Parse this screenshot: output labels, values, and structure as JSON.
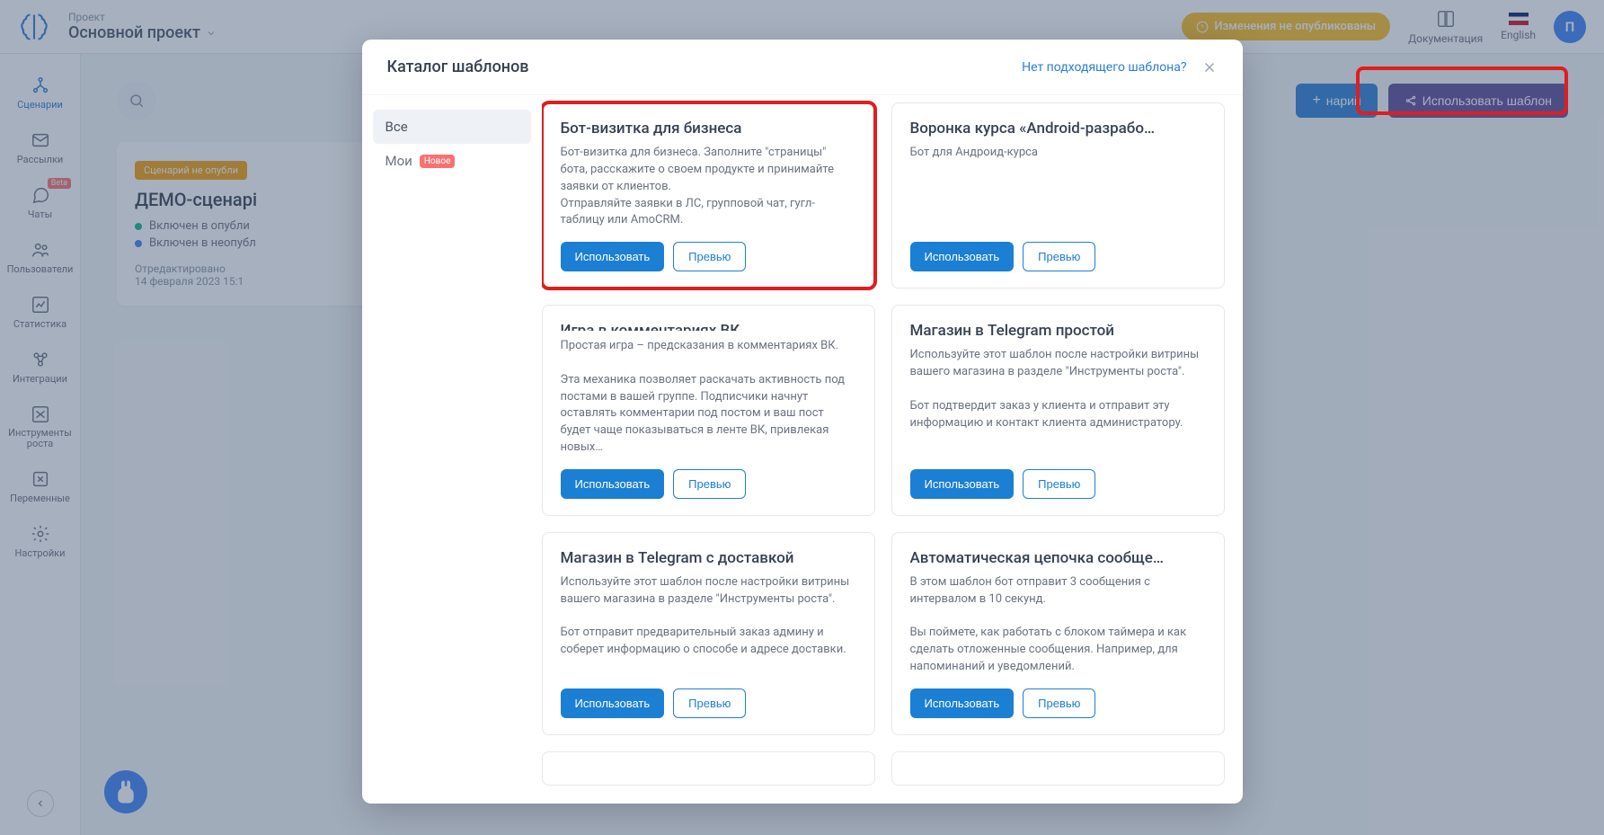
{
  "header": {
    "project_label": "Проект",
    "project_name": "Основной проект",
    "warning": "Изменения не опубликованы",
    "doc_label": "Документация",
    "lang_label": "English",
    "avatar_initial": "П"
  },
  "nav": {
    "items": [
      {
        "label": "Сценарии"
      },
      {
        "label": "Рассылки"
      },
      {
        "label": "Чаты",
        "badge": "Beta"
      },
      {
        "label": "Пользователи"
      },
      {
        "label": "Статистика"
      },
      {
        "label": "Интеграции"
      },
      {
        "label": "Инструменты роста"
      },
      {
        "label": "Переменные"
      },
      {
        "label": "Настройки"
      }
    ]
  },
  "main": {
    "scenario_tag": "Сценарий не опубли",
    "scenario_title": "ДЕМО-сценарі",
    "status_published": "Включен в опубли",
    "status_unpublished": "Включен в неопубл",
    "edited_label": "Отредактировано",
    "edited_value": "14 февраля 2023 15:1",
    "add_scenario_btn": "нарий",
    "use_template_btn": "Использовать шаблон"
  },
  "modal": {
    "title": "Каталог шаблонов",
    "no_suitable_link": "Нет подходящего шаблона?",
    "categories": {
      "all": "Все",
      "mine": "Мои",
      "mine_badge": "Новое"
    },
    "use_label": "Использовать",
    "preview_label": "Превью",
    "templates": [
      {
        "title": "Бот-визитка для бизнеса",
        "desc": "Бот-визитка для бизнеса. Заполните \"страницы\" бота, расскажите о своем продукте и принимайте заявки от клиентов.\nОтправляйте заявки в ЛС, групповой чат, гугл-таблицу или AmoCRM.",
        "highlighted": true
      },
      {
        "title": "Воронка курса «Android-разрабо…",
        "desc": "Бот для Андроид-курса"
      },
      {
        "title": "Игра в комментариях ВК",
        "desc": "Простая игра – предсказания в комментариях ВК.\n\nЭта механика позволяет раскачать активность под постами в вашей группе. Подписчики начнут оставлять комментарии под постом и ваш пост будет чаще показываться в ленте ВК, привлекая новых…"
      },
      {
        "title": "Магазин в Telegram простой",
        "desc": "Используйте этот шаблон после настройки витрины вашего магазина в разделе \"Инструменты роста\".\n\nБот подтвердит заказ у клиента и отправит эту информацию и контакт клиента администратору."
      },
      {
        "title": "Магазин в Telegram с доставкой",
        "desc": "Используйте этот шаблон после настройки витрины вашего магазина в разделе \"Инструменты роста\".\n\nБот отправит предварительный заказ админу и соберет информацию о способе и адресе доставки."
      },
      {
        "title": "Автоматическая цепочка сообще…",
        "desc": "В этом шаблон бот отправит 3 сообщения с интервалом в 10 секунд.\n\nВы поймете, как работать с блоком таймера и как сделать отложенные сообщения. Например, для напоминаний и уведомлений."
      }
    ]
  }
}
